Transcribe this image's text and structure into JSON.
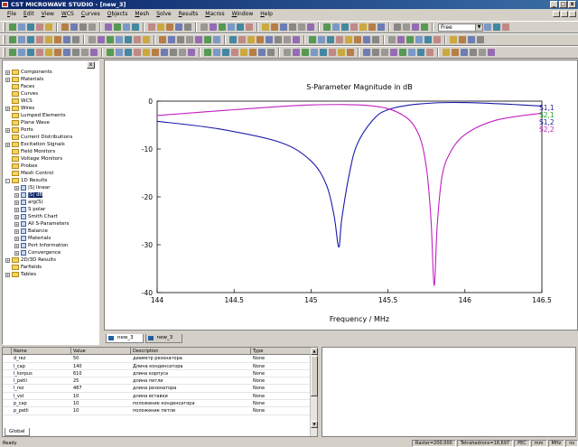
{
  "window": {
    "title": "CST MICROWAVE STUDIO - [new_3]",
    "minimize": "_",
    "maximize": "□",
    "close": "x"
  },
  "menu": [
    "File",
    "Edit",
    "View",
    "WCS",
    "Curves",
    "Objects",
    "Mesh",
    "Solve",
    "Results",
    "Macros",
    "Window",
    "Help"
  ],
  "toolbar": {
    "mode_select": "Free"
  },
  "tree": [
    {
      "label": "Components",
      "level": 0,
      "expander": "+",
      "icon": "folder"
    },
    {
      "label": "Materials",
      "level": 0,
      "expander": "+",
      "icon": "folder"
    },
    {
      "label": "Faces",
      "level": 0,
      "expander": "",
      "icon": "folder"
    },
    {
      "label": "Curves",
      "level": 0,
      "expander": "",
      "icon": "folder"
    },
    {
      "label": "WCS",
      "level": 0,
      "expander": "",
      "icon": "folder"
    },
    {
      "label": "Wires",
      "level": 0,
      "expander": "+",
      "icon": "folder"
    },
    {
      "label": "Lumped Elements",
      "level": 0,
      "expander": "",
      "icon": "folder"
    },
    {
      "label": "Plane Wave",
      "level": 0,
      "expander": "",
      "icon": "folder"
    },
    {
      "label": "Ports",
      "level": 0,
      "expander": "+",
      "icon": "folder"
    },
    {
      "label": "Current Distributions",
      "level": 0,
      "expander": "",
      "icon": "folder"
    },
    {
      "label": "Excitation Signals",
      "level": 0,
      "expander": "+",
      "icon": "folder"
    },
    {
      "label": "Field Monitors",
      "level": 0,
      "expander": "",
      "icon": "folder"
    },
    {
      "label": "Voltage Monitors",
      "level": 0,
      "expander": "",
      "icon": "folder"
    },
    {
      "label": "Probes",
      "level": 0,
      "expander": "",
      "icon": "folder"
    },
    {
      "label": "Mesh Control",
      "level": 0,
      "expander": "",
      "icon": "folder"
    },
    {
      "label": "1D Results",
      "level": 0,
      "expander": "-",
      "icon": "folder"
    },
    {
      "label": "|S| linear",
      "level": 1,
      "expander": "+",
      "icon": "result"
    },
    {
      "label": "|S| dB",
      "level": 1,
      "expander": "+",
      "icon": "result",
      "selected": true
    },
    {
      "label": "arg(S)",
      "level": 1,
      "expander": "+",
      "icon": "result"
    },
    {
      "label": "S polar",
      "level": 1,
      "expander": "+",
      "icon": "result"
    },
    {
      "label": "Smith Chart",
      "level": 1,
      "expander": "+",
      "icon": "result"
    },
    {
      "label": "All S-Parameters",
      "level": 1,
      "expander": "+",
      "icon": "result"
    },
    {
      "label": "Balance",
      "level": 1,
      "expander": "+",
      "icon": "result"
    },
    {
      "label": "Materials",
      "level": 1,
      "expander": "+",
      "icon": "result"
    },
    {
      "label": "Port Information",
      "level": 1,
      "expander": "+",
      "icon": "result"
    },
    {
      "label": "Convergence",
      "level": 1,
      "expander": "+",
      "icon": "result"
    },
    {
      "label": "2D/3D Results",
      "level": 0,
      "expander": "+",
      "icon": "folder"
    },
    {
      "label": "Farfields",
      "level": 0,
      "expander": "",
      "icon": "folder"
    },
    {
      "label": "Tables",
      "level": 0,
      "expander": "+",
      "icon": "folder"
    }
  ],
  "chart_data": {
    "type": "line",
    "title": "S-Parameter Magnitude in dB",
    "xlabel": "Frequency / MHz",
    "ylabel": "",
    "xlim": [
      144,
      146.5
    ],
    "ylim": [
      -40,
      0
    ],
    "xticks": [
      "144",
      "144.5",
      "145",
      "145.5",
      "146",
      "146.5"
    ],
    "yticks": [
      "0",
      "-10",
      "-20",
      "-30",
      "-40"
    ],
    "grid": false,
    "legend_position": "top-right",
    "series": [
      {
        "name": "S1,1",
        "color": "#1a1aa8",
        "x": [
          144,
          144.4,
          144.8,
          145,
          145.1,
          145.15,
          145.18,
          145.2,
          145.25,
          145.3,
          145.4,
          145.5,
          145.7,
          146,
          146.5
        ],
        "y": [
          -4.2,
          -5.8,
          -8.6,
          -12.5,
          -17.5,
          -24,
          -30.5,
          -24.5,
          -15,
          -9,
          -4,
          -1.8,
          -0.6,
          -0.3,
          -1
        ]
      },
      {
        "name": "S2,1",
        "color": "#22a022",
        "x": [],
        "y": []
      },
      {
        "name": "S1,2",
        "color": "#1a1aa8",
        "x": [],
        "y": []
      },
      {
        "name": "S2,2",
        "color": "#c020c0",
        "x": [
          144,
          144.5,
          145,
          145.4,
          145.6,
          145.7,
          145.75,
          145.78,
          145.8,
          145.82,
          145.85,
          145.9,
          146,
          146.2,
          146.5
        ],
        "y": [
          -3,
          -1.8,
          -0.8,
          -1,
          -3,
          -7,
          -14,
          -25,
          -38.5,
          -26,
          -16,
          -11,
          -7,
          -4,
          -2.5
        ]
      }
    ]
  },
  "tabs": [
    {
      "label": "new_3",
      "active": true
    },
    {
      "label": "new_3",
      "active": false
    }
  ],
  "parameters": {
    "columns": [
      "Name",
      "Value",
      "Description",
      "Type"
    ],
    "rows": [
      [
        "d_rez",
        "50",
        "диаметр резонатора",
        "None"
      ],
      [
        "l_cap",
        "140",
        "Длина конденсатора",
        "None"
      ],
      [
        "l_korpus",
        "610",
        "длина корпуса",
        "None"
      ],
      [
        "l_petli",
        "25",
        "длина петли",
        "None"
      ],
      [
        "l_rez",
        "487",
        "длина резонатора",
        "None"
      ],
      [
        "l_vst",
        "10",
        "длина вставки",
        "None"
      ],
      [
        "p_cap",
        "10",
        "положение конденсатора",
        "None"
      ],
      [
        "p_petli",
        "10",
        "положение петли",
        "None"
      ]
    ],
    "tab": "Global"
  },
  "status": {
    "ready": "Ready",
    "raster": "Raster=200.000",
    "tetra": "Tetrahedrons=18,697",
    "pec": "PEC",
    "unit1": "mm",
    "unit2": "MHz",
    "unit3": "ns"
  }
}
